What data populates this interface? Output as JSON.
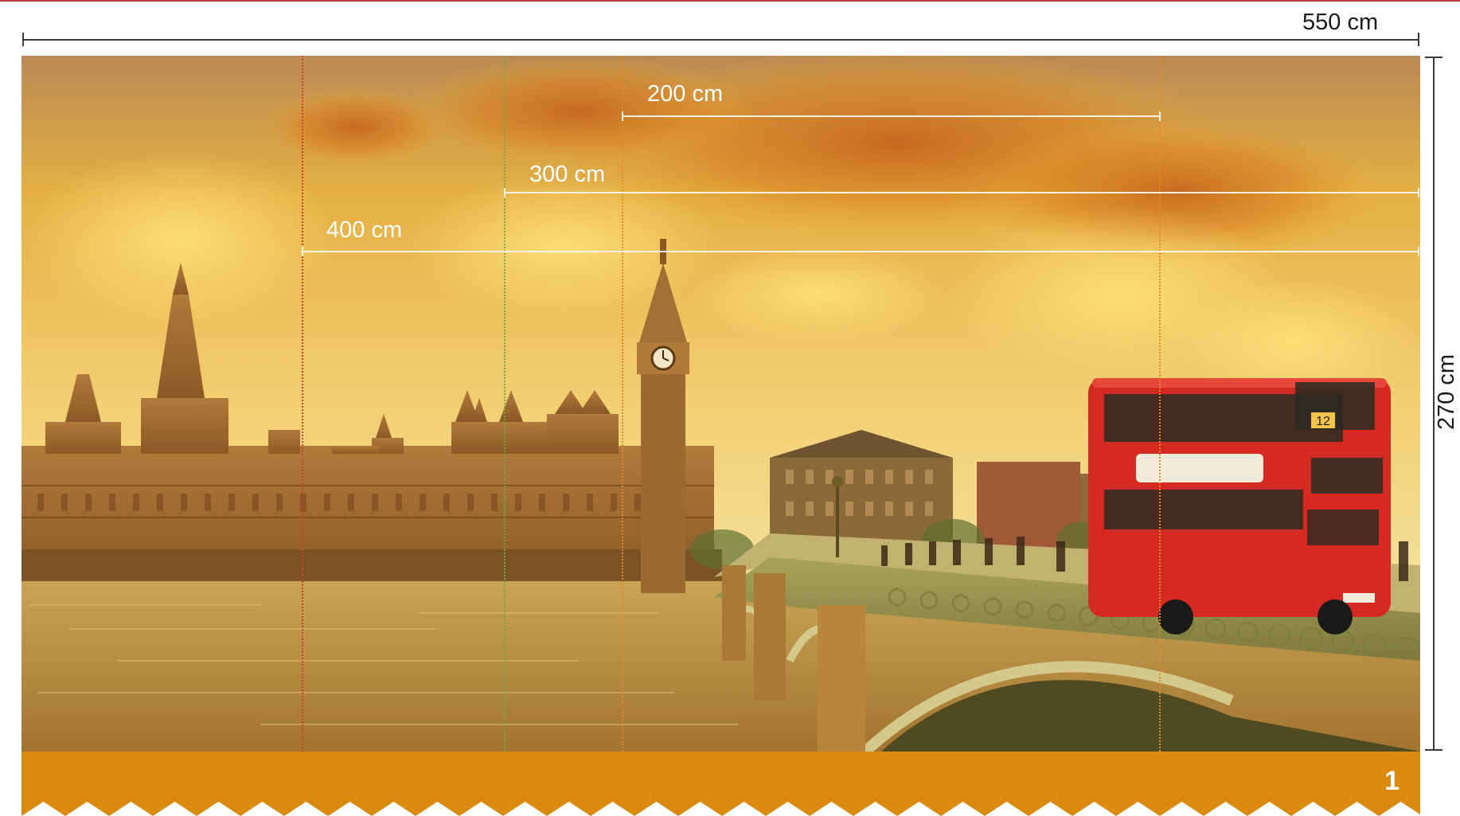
{
  "overall": {
    "width_label": "550 cm",
    "height_label": "270 cm"
  },
  "measurements": [
    {
      "label": "200 cm",
      "color": "#ffffff"
    },
    {
      "label": "300 cm",
      "color": "#ffffff"
    },
    {
      "label": "400 cm",
      "color": "#ffffff"
    }
  ],
  "guide_colors": {
    "cut_400": "#d83a2a",
    "cut_300": "#6fa844",
    "cut_200": "#e08a2a",
    "cut_200_right": "#e08a2a"
  },
  "footer": {
    "panel_number": "1",
    "band_color": "#d98a0f"
  },
  "image": {
    "description_icon": "london-westminster-photo",
    "bus_route": "12"
  },
  "colors": {
    "frame_accent": "#c0393b",
    "dimension_line": "#3a3a3a"
  }
}
